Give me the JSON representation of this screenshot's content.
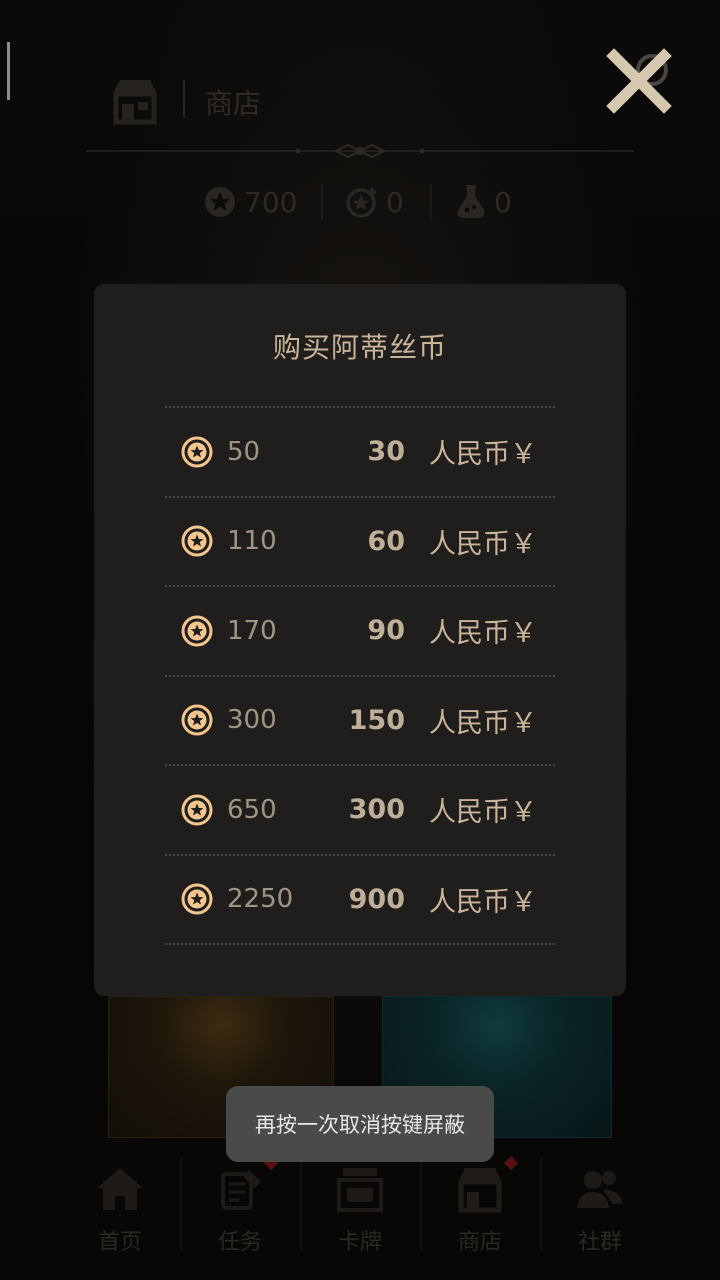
{
  "header": {
    "title": "商店"
  },
  "currencies": [
    {
      "icon": "star-coin-icon",
      "value": "700"
    },
    {
      "icon": "star-plus-icon",
      "value": "0"
    },
    {
      "icon": "potion-icon",
      "value": "0"
    }
  ],
  "modal": {
    "title": "购买阿蒂丝币",
    "unit_label": "人民币￥",
    "options": [
      {
        "amount": "50",
        "price": "30"
      },
      {
        "amount": "110",
        "price": "60"
      },
      {
        "amount": "170",
        "price": "90"
      },
      {
        "amount": "300",
        "price": "150"
      },
      {
        "amount": "650",
        "price": "300"
      },
      {
        "amount": "2250",
        "price": "900"
      }
    ]
  },
  "toast": {
    "message": "再按一次取消按键屏蔽"
  },
  "bottom_nav": {
    "items": [
      {
        "label": "首页",
        "icon": "home-icon"
      },
      {
        "label": "任务",
        "icon": "quest-scroll-icon"
      },
      {
        "label": "卡牌",
        "icon": "cards-icon"
      },
      {
        "label": "商店",
        "icon": "shop-icon"
      },
      {
        "label": "社群",
        "icon": "community-icon"
      }
    ]
  },
  "colors": {
    "accent": "#c9b49a",
    "coin": "#f3c58f",
    "modal_bg": "#201e1c",
    "toast_bg": "#4a4a4a"
  }
}
